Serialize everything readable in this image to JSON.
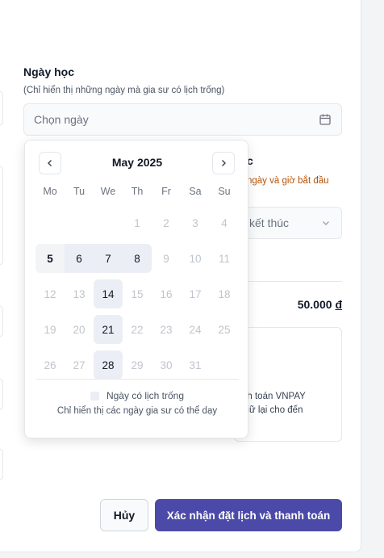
{
  "form": {
    "date_label": "Ngày học",
    "date_hint": "(Chỉ hiển thị những ngày mà gia sư có lịch trống)",
    "date_placeholder": "Chọn ngày",
    "partial_label_tail": "c",
    "warning_partial": "ngày và giờ bắt đầu",
    "end_time_placeholder": "kết thúc",
    "price": "50.000",
    "currency": "đ",
    "payment_note_line1": "nh toán VNPAY",
    "payment_note_line2": "giữ lại cho đến"
  },
  "calendar": {
    "month_title": "May 2025",
    "weekdays": [
      "Mo",
      "Tu",
      "We",
      "Th",
      "Fr",
      "Sa",
      "Su"
    ],
    "days": [
      {
        "label": "",
        "state": "empty"
      },
      {
        "label": "",
        "state": "empty"
      },
      {
        "label": "",
        "state": "empty"
      },
      {
        "label": "1",
        "state": "disabled"
      },
      {
        "label": "2",
        "state": "disabled"
      },
      {
        "label": "3",
        "state": "disabled"
      },
      {
        "label": "4",
        "state": "disabled"
      },
      {
        "label": "5",
        "state": "today"
      },
      {
        "label": "6",
        "state": "available"
      },
      {
        "label": "7",
        "state": "available"
      },
      {
        "label": "8",
        "state": "available"
      },
      {
        "label": "9",
        "state": "disabled"
      },
      {
        "label": "10",
        "state": "disabled"
      },
      {
        "label": "11",
        "state": "disabled"
      },
      {
        "label": "12",
        "state": "disabled"
      },
      {
        "label": "13",
        "state": "disabled"
      },
      {
        "label": "14",
        "state": "available"
      },
      {
        "label": "15",
        "state": "disabled"
      },
      {
        "label": "16",
        "state": "disabled"
      },
      {
        "label": "17",
        "state": "disabled"
      },
      {
        "label": "18",
        "state": "disabled"
      },
      {
        "label": "19",
        "state": "disabled"
      },
      {
        "label": "20",
        "state": "disabled"
      },
      {
        "label": "21",
        "state": "available"
      },
      {
        "label": "22",
        "state": "disabled"
      },
      {
        "label": "23",
        "state": "disabled"
      },
      {
        "label": "24",
        "state": "disabled"
      },
      {
        "label": "25",
        "state": "disabled"
      },
      {
        "label": "26",
        "state": "disabled"
      },
      {
        "label": "27",
        "state": "disabled"
      },
      {
        "label": "28",
        "state": "available"
      },
      {
        "label": "29",
        "state": "disabled"
      },
      {
        "label": "30",
        "state": "disabled"
      },
      {
        "label": "31",
        "state": "disabled"
      }
    ],
    "legend_label": "Ngày có lịch trống",
    "legend_note": "Chỉ hiển thị các ngày gia sư có thể dạy",
    "available_color": "#eceef5"
  },
  "actions": {
    "cancel_label": "Hủy",
    "confirm_label": "Xác nhận đặt lịch và thanh toán",
    "confirm_color": "#4c4aa8"
  },
  "icons": {
    "date_input": "calendar-icon",
    "prev": "chevron-left-icon",
    "next": "chevron-right-icon",
    "end_select": "chevron-down-icon"
  }
}
